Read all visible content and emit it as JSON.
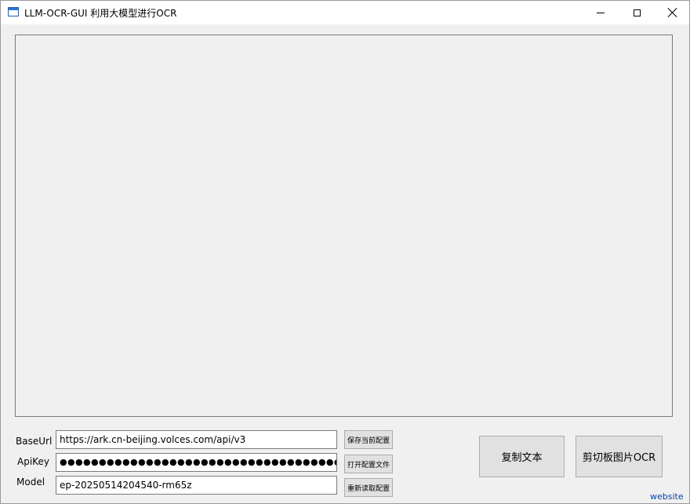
{
  "window": {
    "title": "LLM-OCR-GUI 利用大模型进行OCR"
  },
  "form": {
    "base_url_label": "BaseUrl",
    "base_url_value": "https://ark.cn-beijing.volces.com/api/v3",
    "api_key_label": "ApiKey",
    "api_key_value": "●●●●●●●●●●●●●●●●●●●●●●●●●●●●●●●●●●●●",
    "model_label": "Model",
    "model_value": "ep-20250514204540-rm65z"
  },
  "buttons": {
    "save_config": "保存当前配置",
    "open_config": "打开配置文件",
    "reload_config": "重新读取配置",
    "copy_text": "复制文本",
    "clipboard_ocr": "剪切板图片OCR"
  },
  "footer": {
    "website_link": "website"
  },
  "icons": {
    "app": "window-icon",
    "minimize": "minimize-icon",
    "maximize": "maximize-icon",
    "close": "close-icon"
  },
  "colors": {
    "link": "#0645ad",
    "title_bar": "#ffffff",
    "window_bg": "#f0f0f0"
  }
}
